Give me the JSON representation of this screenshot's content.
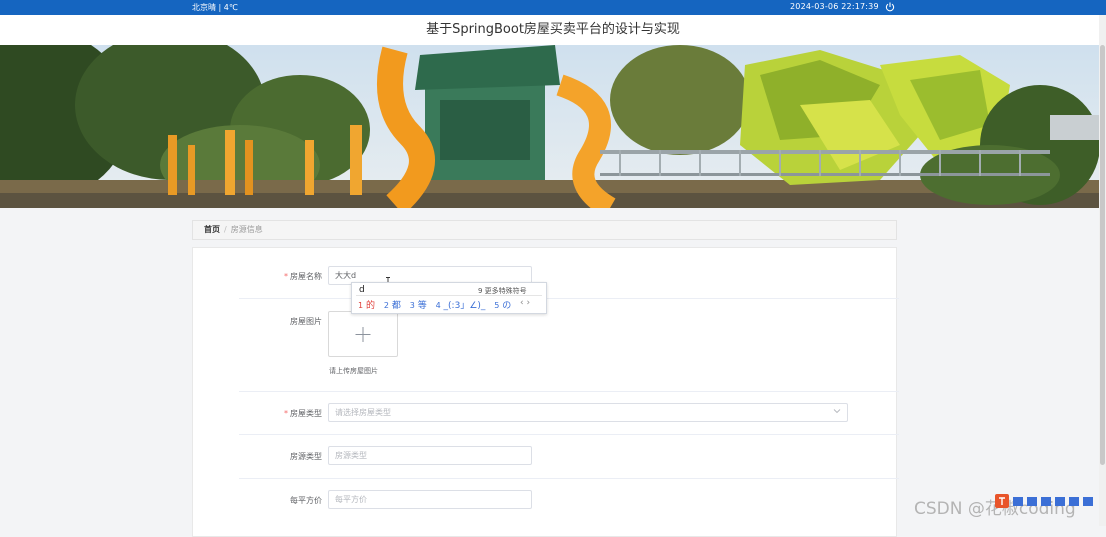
{
  "topbar": {
    "weather": "北京晴 | 4℃",
    "datetime": "2024-03-06  22:17:39",
    "power_icon": "power-icon",
    "bg_color": "#1565c0"
  },
  "site": {
    "title": "基于SpringBoot房屋买卖平台的设计与实现"
  },
  "breadcrumb": {
    "home": "首页",
    "separator": "/",
    "current": "房源信息"
  },
  "form": {
    "house_name": {
      "label": "房屋名称",
      "value": "大大d"
    },
    "house_image": {
      "label": "房屋图片",
      "hint": "请上传房屋图片"
    },
    "house_type": {
      "label": "房屋类型",
      "placeholder": "请选择房屋类型"
    },
    "source_type": {
      "label": "房源类型",
      "placeholder": "房源类型"
    },
    "price_per_sqm": {
      "label": "每平方价",
      "placeholder": "每平方价"
    }
  },
  "ime": {
    "composition": "d",
    "more_symbols": "9 更多特殊符号",
    "candidates": [
      {
        "num": "1",
        "text": "的"
      },
      {
        "num": "2",
        "text": "都"
      },
      {
        "num": "3",
        "text": "等"
      },
      {
        "num": "4",
        "text": "_(:3」∠)_"
      },
      {
        "num": "5",
        "text": "の"
      }
    ],
    "nav": "‹ ›"
  },
  "watermark": "CSDN @花椒coding"
}
